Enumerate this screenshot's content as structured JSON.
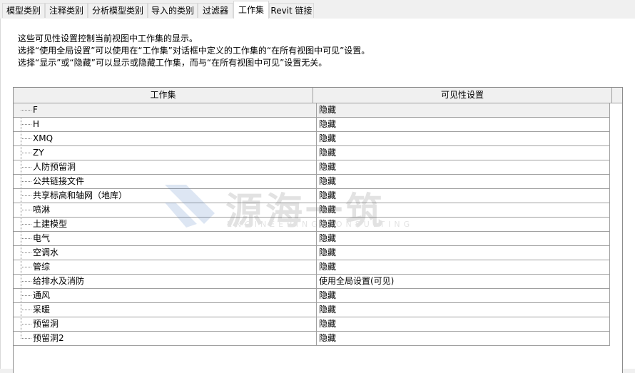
{
  "tabs": [
    "模型类别",
    "注释类别",
    "分析模型类别",
    "导入的类别",
    "过滤器",
    "工作集",
    "Revit 链接"
  ],
  "active_tab": "工作集",
  "description": [
    "这些可见性设置控制当前视图中工作集的显示。",
    "选择“使用全局设置”可以使用在“工作集”对话框中定义的工作集的“在所有视图中可见”设置。",
    "选择“显示”或“隐藏”可以显示或隐藏工作集，而与“在所有视图中可见”设置无关。"
  ],
  "table": {
    "headers": [
      "工作集",
      "可见性设置"
    ],
    "rows": [
      {
        "name": "F",
        "vis": "隐藏"
      },
      {
        "name": "H",
        "vis": "隐藏"
      },
      {
        "name": "XMQ",
        "vis": "隐藏"
      },
      {
        "name": "ZY",
        "vis": "隐藏"
      },
      {
        "name": "人防预留洞",
        "vis": "隐藏"
      },
      {
        "name": "公共链接文件",
        "vis": "隐藏"
      },
      {
        "name": "共享标高和轴网（地库）",
        "vis": "隐藏"
      },
      {
        "name": "喷淋",
        "vis": "隐藏"
      },
      {
        "name": "土建模型",
        "vis": "隐藏"
      },
      {
        "name": "电气",
        "vis": "隐藏"
      },
      {
        "name": "空调水",
        "vis": "隐藏"
      },
      {
        "name": "管综",
        "vis": "隐藏"
      },
      {
        "name": "给排水及消防",
        "vis": "使用全局设置(可见)"
      },
      {
        "name": "通风",
        "vis": "隐藏"
      },
      {
        "name": "采暖",
        "vis": "隐藏"
      },
      {
        "name": "预留洞",
        "vis": "隐藏"
      },
      {
        "name": "预留洞2",
        "vis": "隐藏"
      }
    ]
  },
  "watermark": {
    "title": "源海一筑",
    "subtitle": "ENGINEERING CONSULTING"
  }
}
